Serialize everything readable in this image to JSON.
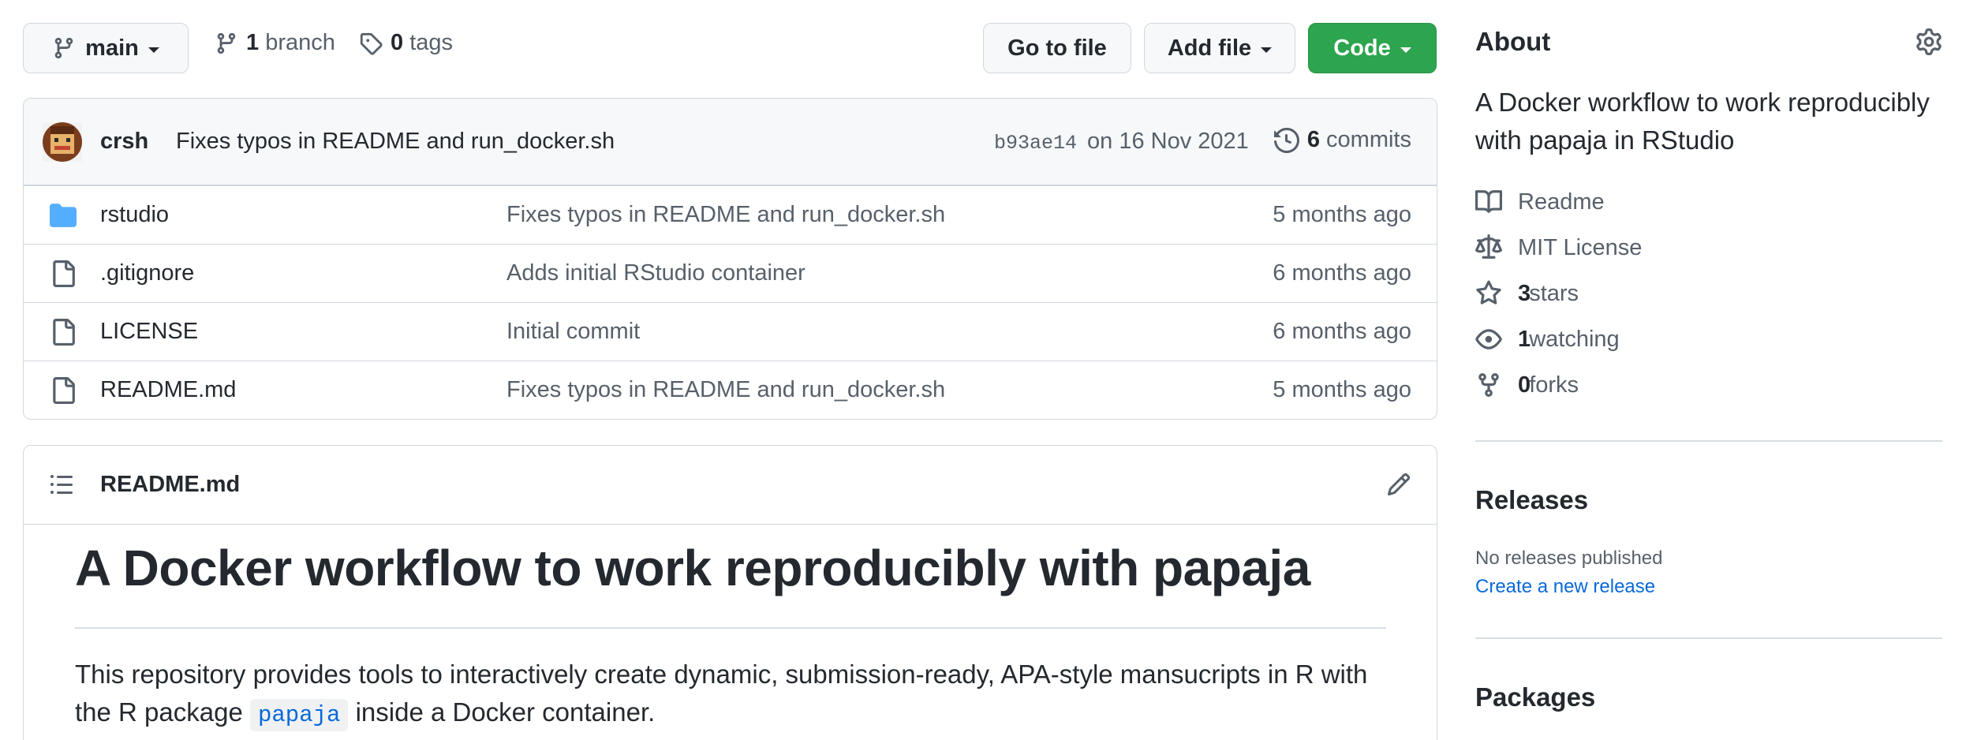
{
  "toolbar": {
    "branch_name": "main",
    "branches_count": "1",
    "branches_label": "branch",
    "tags_count": "0",
    "tags_label": "tags",
    "go_to_file": "Go to file",
    "add_file": "Add file",
    "code": "Code"
  },
  "commit": {
    "author": "crsh",
    "message": "Fixes typos in README and run_docker.sh",
    "sha": "b93ae14",
    "date": "on 16 Nov 2021",
    "commits_count": "6",
    "commits_label": "commits"
  },
  "files": [
    {
      "type": "folder",
      "name": "rstudio",
      "message": "Fixes typos in README and run_docker.sh",
      "age": "5 months ago"
    },
    {
      "type": "file",
      "name": ".gitignore",
      "message": "Adds initial RStudio container",
      "age": "6 months ago"
    },
    {
      "type": "file",
      "name": "LICENSE",
      "message": "Initial commit",
      "age": "6 months ago"
    },
    {
      "type": "file",
      "name": "README.md",
      "message": "Fixes typos in README and run_docker.sh",
      "age": "5 months ago"
    }
  ],
  "readme": {
    "filename": "README.md",
    "heading": "A Docker workflow to work reproducibly with papaja",
    "para_start": "This repository provides tools to interactively create dynamic, submission-ready, APA-style mansucripts in R with",
    "para_pre_code": "the R package ",
    "para_code": "papaja",
    "para_post_code": " inside a Docker container."
  },
  "about": {
    "title": "About",
    "description": "A Docker workflow to work reproducibly with papaja in RStudio",
    "readme": "Readme",
    "license": "MIT License",
    "stars_count": "3",
    "stars_label": "stars",
    "watching_count": "1",
    "watching_label": "watching",
    "forks_count": "0",
    "forks_label": "forks"
  },
  "releases": {
    "title": "Releases",
    "none": "No releases published",
    "create": "Create a new release"
  },
  "packages": {
    "title": "Packages"
  },
  "colors": {
    "accent_blue": "#0969da",
    "code_green": "#2da44e",
    "folder_blue": "#54aeff"
  }
}
